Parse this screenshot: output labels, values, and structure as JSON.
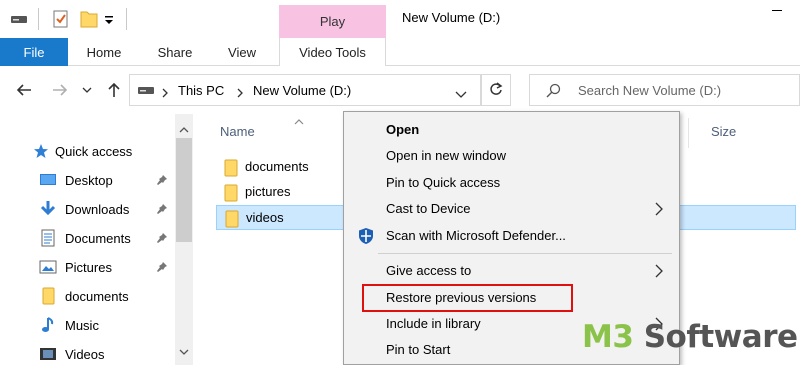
{
  "window": {
    "title": "New Volume (D:)",
    "contextual_tab_group": "Play"
  },
  "ribbon": {
    "tabs": [
      {
        "label": "File"
      },
      {
        "label": "Home"
      },
      {
        "label": "Share"
      },
      {
        "label": "View"
      },
      {
        "label": "Video Tools"
      }
    ]
  },
  "address": {
    "breadcrumbs": [
      "This PC",
      "New Volume (D:)"
    ]
  },
  "search": {
    "placeholder": "Search New Volume (D:)",
    "value": ""
  },
  "navpane": {
    "items": [
      {
        "label": "Quick access",
        "icon": "star-icon",
        "pinned": false
      },
      {
        "label": "Desktop",
        "icon": "desktop-icon",
        "pinned": true
      },
      {
        "label": "Downloads",
        "icon": "download-icon",
        "pinned": true
      },
      {
        "label": "Documents",
        "icon": "documents-icon",
        "pinned": true
      },
      {
        "label": "Pictures",
        "icon": "pictures-icon",
        "pinned": true
      },
      {
        "label": "documents",
        "icon": "folder-icon",
        "pinned": false
      },
      {
        "label": "Music",
        "icon": "music-icon",
        "pinned": false
      },
      {
        "label": "Videos",
        "icon": "videos-icon",
        "pinned": false
      }
    ]
  },
  "filelist": {
    "columns": [
      "Name",
      "Size"
    ],
    "rows": [
      {
        "name": "documents",
        "selected": false
      },
      {
        "name": "pictures",
        "selected": false
      },
      {
        "name": "videos",
        "selected": true
      }
    ]
  },
  "context_menu": {
    "items": [
      {
        "label": "Open",
        "bold": true,
        "submenu": false
      },
      {
        "label": "Open in new window",
        "bold": false,
        "submenu": false
      },
      {
        "label": "Pin to Quick access",
        "bold": false,
        "submenu": false
      },
      {
        "label": "Cast to Device",
        "bold": false,
        "submenu": true
      },
      {
        "label": "Scan with Microsoft Defender...",
        "bold": false,
        "submenu": false,
        "icon": "defender-shield-icon"
      },
      {
        "label": "Give access to",
        "bold": false,
        "submenu": true
      },
      {
        "label": "Restore previous versions",
        "bold": false,
        "submenu": false,
        "highlighted": true
      },
      {
        "label": "Include in library",
        "bold": false,
        "submenu": true
      },
      {
        "label": "Pin to Start",
        "bold": false,
        "submenu": false
      }
    ]
  },
  "watermark": {
    "part1": "M3",
    "part2": " Software"
  },
  "colors": {
    "file_tab": "#1979ca",
    "contextual_tab": "#f8c2e2",
    "selection": "#cce8ff",
    "highlight_border": "#e01010",
    "folder": "#ffd867",
    "watermark_green": "#8bc34a"
  }
}
